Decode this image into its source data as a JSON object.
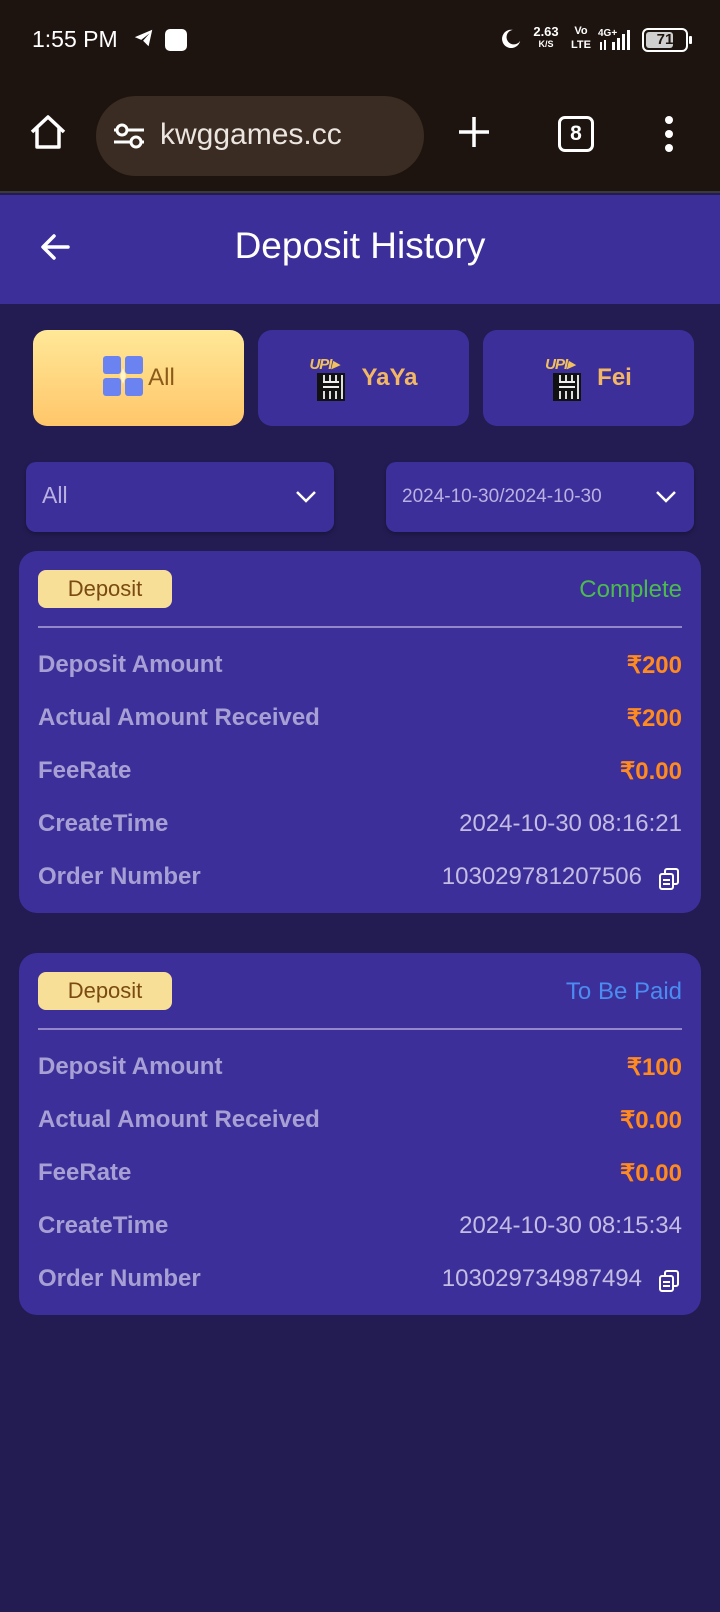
{
  "status_bar": {
    "time": "1:55 PM",
    "net_speed": "2.63",
    "net_unit": "K/S",
    "volte_top": "Vo",
    "volte_bottom": "LTE",
    "network": "4G+",
    "battery": "71",
    "battery_level": 0.71
  },
  "browser": {
    "url": "kwggames.cc",
    "tab_count": "8"
  },
  "header": {
    "title": "Deposit History"
  },
  "channel_tabs": [
    {
      "label": "All",
      "icon": "grid-icon",
      "active": true
    },
    {
      "label": "YaYa",
      "icon": "upi-qr-icon",
      "active": false
    },
    {
      "label": "Fei",
      "icon": "upi-qr-icon",
      "active": false
    }
  ],
  "filters": {
    "status_select": "All",
    "date_range": "2024-10-30/2024-10-30"
  },
  "colors": {
    "accent_purple": "#3d2f9a",
    "background": "#221c52",
    "amount_orange": "#ff8a1f",
    "status_complete": "#4cbb4f",
    "status_pending": "#4a8cf0",
    "badge_bg": "#f7df98"
  },
  "records": [
    {
      "type": "Deposit",
      "status": "Complete",
      "status_color": "#4cbb4f",
      "fields": {
        "deposit_amount_label": "Deposit Amount",
        "deposit_amount": "₹200",
        "actual_received_label": "Actual Amount Received",
        "actual_received": "₹200",
        "fee_rate_label": "FeeRate",
        "fee_rate": "₹0.00",
        "create_time_label": "CreateTime",
        "create_time": "2024-10-30 08:16:21",
        "order_number_label": "Order Number",
        "order_number": "103029781207506"
      }
    },
    {
      "type": "Deposit",
      "status": "To Be Paid",
      "status_color": "#4a8cf0",
      "fields": {
        "deposit_amount_label": "Deposit Amount",
        "deposit_amount": "₹100",
        "actual_received_label": "Actual Amount Received",
        "actual_received": "₹0.00",
        "fee_rate_label": "FeeRate",
        "fee_rate": "₹0.00",
        "create_time_label": "CreateTime",
        "create_time": "2024-10-30 08:15:34",
        "order_number_label": "Order Number",
        "order_number": "103029734987494"
      }
    }
  ]
}
